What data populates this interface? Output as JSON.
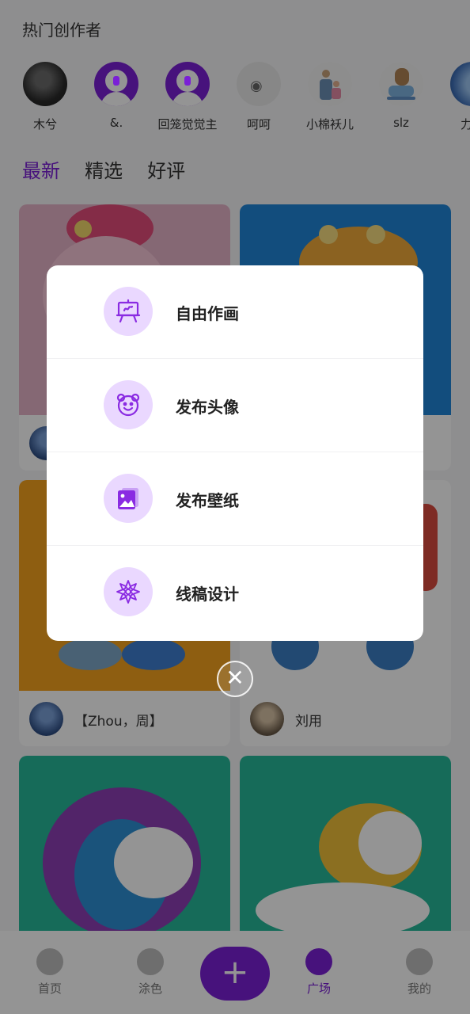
{
  "section": {
    "title": "热门创作者"
  },
  "creators": [
    {
      "name": "木兮",
      "avatar": "dark"
    },
    {
      "name": "&.",
      "avatar": "purple"
    },
    {
      "name": "回笼觉觉主",
      "avatar": "purple"
    },
    {
      "name": "呵呵",
      "avatar": "gray"
    },
    {
      "name": "小棉袄儿",
      "avatar": "light"
    },
    {
      "name": "slz",
      "avatar": "light"
    },
    {
      "name": "力神",
      "avatar": "blue"
    }
  ],
  "tabs": [
    {
      "label": "最新",
      "active": true
    },
    {
      "label": "精选",
      "active": false
    },
    {
      "label": "好评",
      "active": false
    }
  ],
  "cards": [
    {
      "user": "【Zhou，周】"
    },
    {
      "user": "刘用"
    }
  ],
  "modal": {
    "options": [
      {
        "label": "自由作画",
        "icon": "easel-icon"
      },
      {
        "label": "发布头像",
        "icon": "bear-face-icon"
      },
      {
        "label": "发布壁纸",
        "icon": "wallpaper-icon"
      },
      {
        "label": "线稿设计",
        "icon": "flower-mandala-icon"
      }
    ],
    "close_glyph": "✕"
  },
  "nav": {
    "items": [
      {
        "label": "首页",
        "icon": "compass-icon",
        "active": false
      },
      {
        "label": "涂色",
        "icon": "brush-icon",
        "active": false
      },
      {
        "label": "广场",
        "icon": "planet-icon",
        "active": true
      },
      {
        "label": "我的",
        "icon": "user-icon",
        "active": false
      }
    ],
    "fab_glyph": "+"
  },
  "colors": {
    "accent": "#7a1fd6",
    "icon_bg": "#ead8ff",
    "overlay": "rgba(0,0,0,0.42)"
  }
}
